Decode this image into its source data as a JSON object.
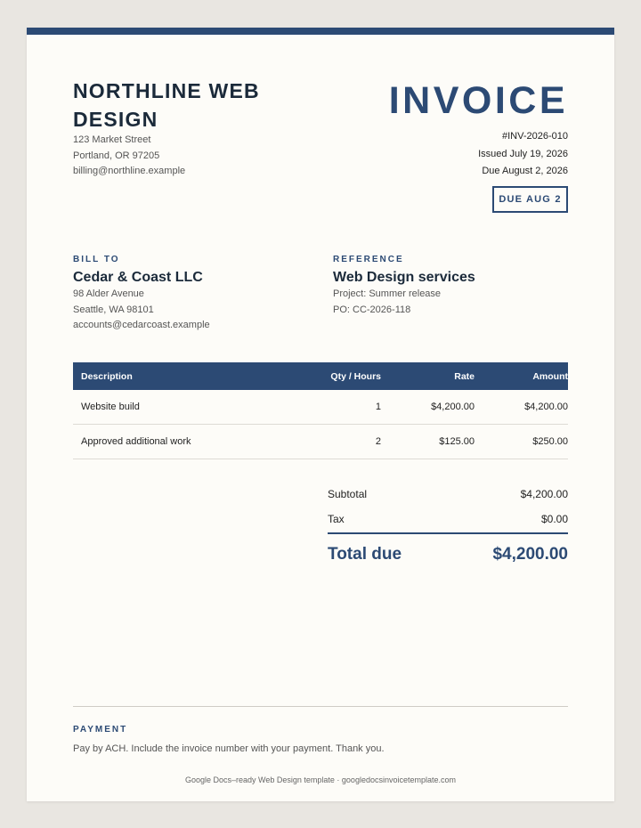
{
  "company": {
    "name": "NORTHLINE WEB DESIGN",
    "address_line1": "123 Market Street",
    "address_line2": "Portland, OR 97205",
    "email": "billing@northline.example"
  },
  "invoice": {
    "title": "INVOICE",
    "number": "#INV-2026-010",
    "issued": "Issued July 19, 2026",
    "due": "Due August 2, 2026",
    "due_badge": "DUE AUG 2"
  },
  "bill_to": {
    "label": "BILL TO",
    "name": "Cedar & Coast LLC",
    "address_line1": "98 Alder Avenue",
    "address_line2": "Seattle, WA 98101",
    "email": "accounts@cedarcoast.example"
  },
  "reference": {
    "label": "REFERENCE",
    "title": "Web Design services",
    "project": "Project: Summer release",
    "po": "PO: CC-2026-118"
  },
  "items": {
    "headers": [
      "Description",
      "Qty / Hours",
      "Rate",
      "Amount"
    ],
    "rows": [
      [
        "Website build",
        "1",
        "$4,200.00",
        "$4,200.00"
      ],
      [
        "Approved additional work",
        "2",
        "$125.00",
        "$250.00"
      ]
    ]
  },
  "totals": {
    "subtotal_label": "Subtotal",
    "subtotal_value": "$4,200.00",
    "tax_label": "Tax",
    "tax_value": "$0.00",
    "total_label": "Total due",
    "total_value": "$4,200.00"
  },
  "payment": {
    "label": "PAYMENT",
    "note": "Pay by ACH. Include the invoice number with your payment. Thank you."
  },
  "footer": "Google Docs–ready Web Design template · googledocsinvoicetemplate.com",
  "colors": {
    "accent": "#2c4a74",
    "page_background": "#fdfcf8",
    "canvas_background": "#e9e6e1"
  }
}
